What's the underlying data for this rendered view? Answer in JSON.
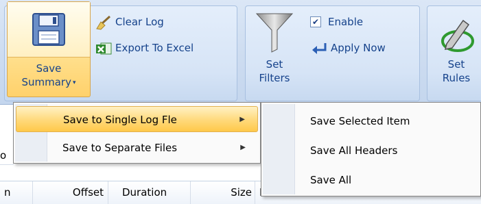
{
  "ribbon": {
    "save_summary": {
      "line1": "Save",
      "line2": "Summary"
    },
    "clear_log": "Clear Log",
    "export_excel": "Export To Excel",
    "set_filters": {
      "line1": "Set",
      "line2": "Filters"
    },
    "enable": "Enable",
    "enable_checked": true,
    "apply_now": "Apply Now",
    "set_rules": {
      "line1": "Set",
      "line2": "Rules"
    }
  },
  "menu": {
    "items": [
      {
        "label": "Save to Single Log Fle"
      },
      {
        "label": "Save to Separate Files"
      }
    ],
    "submenu": [
      {
        "label": "Save Selected Item"
      },
      {
        "label": "Save All Headers"
      },
      {
        "label": "Save All"
      }
    ]
  },
  "grid": {
    "columns": [
      "n",
      "Offset",
      "Duration",
      "Size",
      "Full URL"
    ]
  },
  "stray_text": "o",
  "colors": {
    "ribbon_text": "#15428b",
    "highlight": "#ffd97a"
  }
}
